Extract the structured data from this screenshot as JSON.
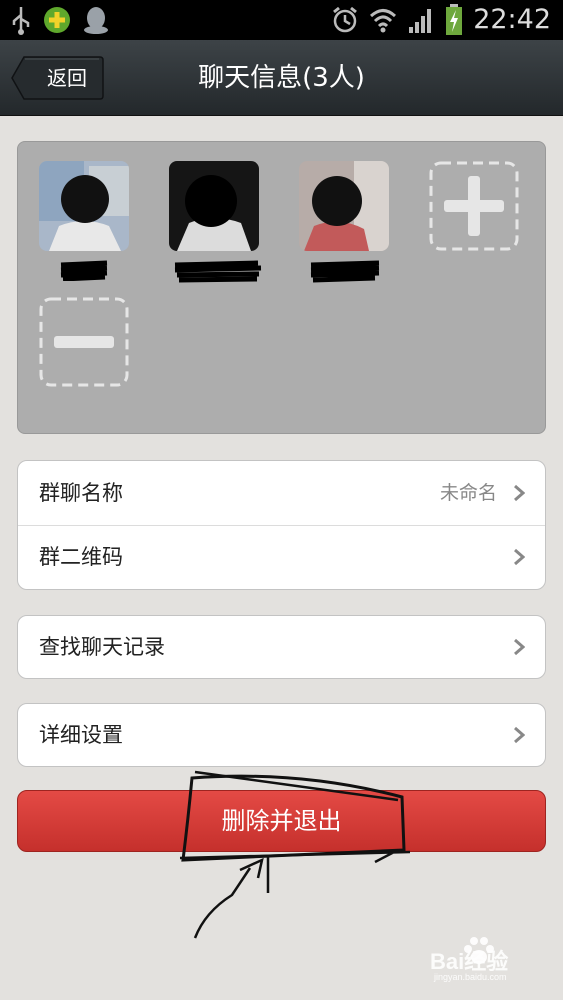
{
  "status_bar": {
    "time": "22:42",
    "icons": [
      "usb-icon",
      "app-icon",
      "qq-icon",
      "alarm-icon",
      "wifi-icon",
      "signal-icon",
      "battery-icon"
    ]
  },
  "title_bar": {
    "back_label": "返回",
    "title": "聊天信息(3人)"
  },
  "members": {
    "count": 3,
    "icons": [
      "add-member-icon",
      "remove-member-icon"
    ]
  },
  "settings": {
    "group1": [
      {
        "label": "群聊名称",
        "value": "未命名"
      },
      {
        "label": "群二维码",
        "value": ""
      }
    ],
    "group2": [
      {
        "label": "查找聊天记录"
      }
    ],
    "group3": [
      {
        "label": "详细设置"
      }
    ]
  },
  "delete_button": {
    "label": "删除并退出"
  },
  "watermark": {
    "text": "Bai经验",
    "sub": "jingyan.baidu.com"
  },
  "colors": {
    "accent_red": "#d63a36",
    "titlebar": "#2e3438",
    "background": "#e3e1de"
  }
}
